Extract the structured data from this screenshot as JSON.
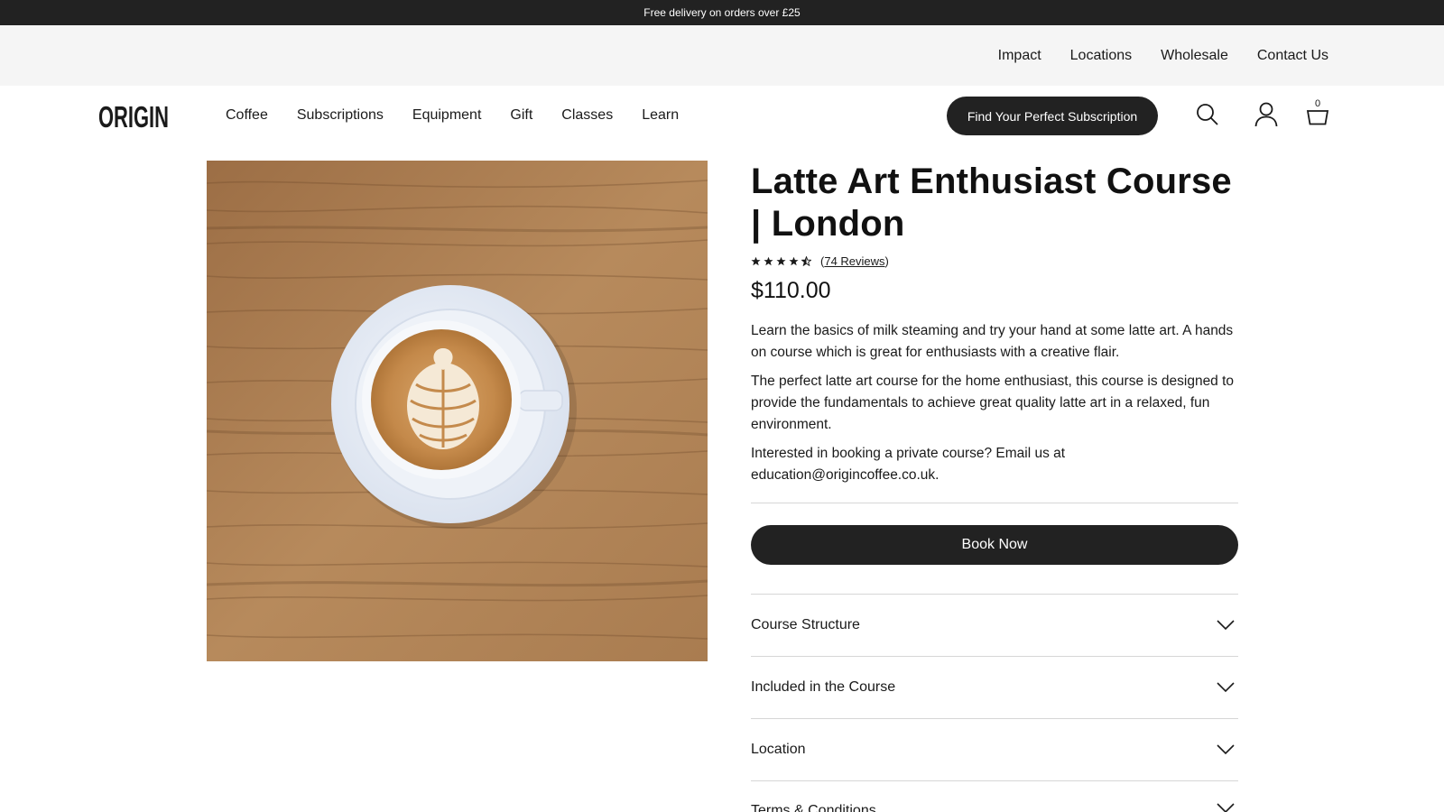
{
  "announcement": "Free delivery on orders over £25",
  "utility_nav": [
    "Impact",
    "Locations",
    "Wholesale",
    "Contact Us"
  ],
  "brand": {
    "logo_text": "ORIGIN",
    "dark": "#222222",
    "light_bg": "#f5f5f5"
  },
  "main_nav": [
    "Coffee",
    "Subscriptions",
    "Equipment",
    "Gift",
    "Classes",
    "Learn"
  ],
  "cta_label": "Find Your Perfect Subscription",
  "header_icons": {
    "search": "search-icon",
    "account": "user-icon",
    "cart": "bag-icon"
  },
  "cart_count": "0",
  "product": {
    "title": "Latte Art Enthusiast Course | London",
    "rating": 4.5,
    "rating_max": 5,
    "reviews_prefix": "(",
    "reviews_label": "74 Reviews",
    "reviews_suffix": ")",
    "price": "$110.00",
    "image_alt": "Latte with rosetta art on a wooden table",
    "description": [
      "Learn the basics of milk steaming and try your hand at some latte art. A hands on course which is great for enthusiasts with a creative flair.",
      "The perfect latte art course for the home enthusiast, this course is designed to provide the fundamentals to achieve great quality latte art in a relaxed, fun environment.",
      "Interested in booking a private course? Email us at education@origincoffee.co.uk."
    ],
    "book_label": "Book Now",
    "accordions": [
      "Course Structure",
      "Included in the Course",
      "Location",
      "Terms & Conditions"
    ]
  }
}
